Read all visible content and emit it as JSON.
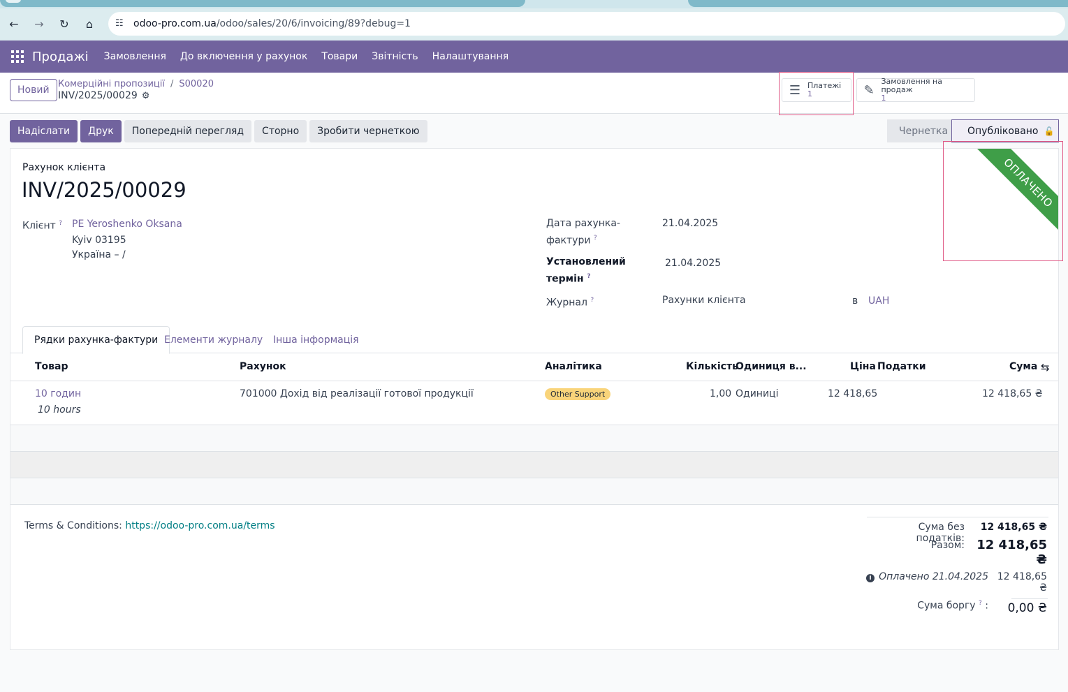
{
  "browser": {
    "url_host": "odoo-pro.com.ua",
    "url_path": "/odoo/sales/20/6/invoicing/89?debug=1"
  },
  "navbar": {
    "brand": "Продажі",
    "menu": [
      "Замовлення",
      "До включення у рахунок",
      "Товари",
      "Звітність",
      "Налаштування"
    ]
  },
  "control": {
    "new_label": "Новий",
    "breadcrumb": [
      "Комерційні пропозиції",
      "S00020"
    ],
    "current": "INV/2025/00029",
    "smart_payments": {
      "label": "Платежі",
      "value": "1"
    },
    "smart_orders": {
      "label": "Замовлення на продаж",
      "value": "1"
    }
  },
  "actions": [
    "Надіслати",
    "Друк",
    "Попередній перегляд",
    "Сторно",
    "Зробити чернеткою"
  ],
  "status": {
    "draft": "Чернетка",
    "posted": "Опубліковано"
  },
  "sheet": {
    "subtitle": "Рахунок клієнта",
    "title": "INV/2025/00029",
    "ribbon": "ОПЛАЧЕНО",
    "client_label": "Клієнт",
    "client_name": "PE Yeroshenko Oksana",
    "client_city": "Kyiv 03195",
    "client_country": "Україна – /",
    "invoice_date_label_1": "Дата рахунка-",
    "invoice_date_label_2": "фактури",
    "invoice_date": "21.04.2025",
    "due_label_1": "Установлений",
    "due_label_2": "термін",
    "due_date": "21.04.2025",
    "journal_label": "Журнал",
    "journal": "Рахунки клієнта",
    "in_label": "в",
    "currency": "UAH",
    "help": "?"
  },
  "tabs": [
    "Рядки рахунка-фактури",
    "Елементи журналу",
    "Інша інформація"
  ],
  "table": {
    "headers": [
      "Товар",
      "Рахунок",
      "Аналітика",
      "Кількість",
      "Одиниця в...",
      "Ціна",
      "Податки",
      "Сума"
    ],
    "rows": [
      {
        "product": "10 годин",
        "description": "10 hours",
        "account": "701000 Дохід від реалізації готової продукції",
        "analytic": "Other Support",
        "qty": "1,00",
        "uom": "Одиниці",
        "price": "12 418,65",
        "taxes": "",
        "subtotal": "12 418,65 ₴"
      }
    ]
  },
  "footer": {
    "terms_label": "Terms & Conditions:",
    "terms_link": "https://odoo-pro.com.ua/terms",
    "untaxed_label": "Сума без податків:",
    "untaxed": "12 418,65 ₴",
    "total_label": "Разом:",
    "total": "12 418,65 ₴",
    "paid_label": "Оплачено 21.04.2025",
    "paid": "12 418,65 ₴",
    "due_label": "Сума боргу",
    "due": "0,00 ₴"
  },
  "colors": {
    "brand": "#71639e",
    "ribbon": "#3f9e48",
    "highlight": "#e05a86",
    "tag": "#f9d47a"
  }
}
